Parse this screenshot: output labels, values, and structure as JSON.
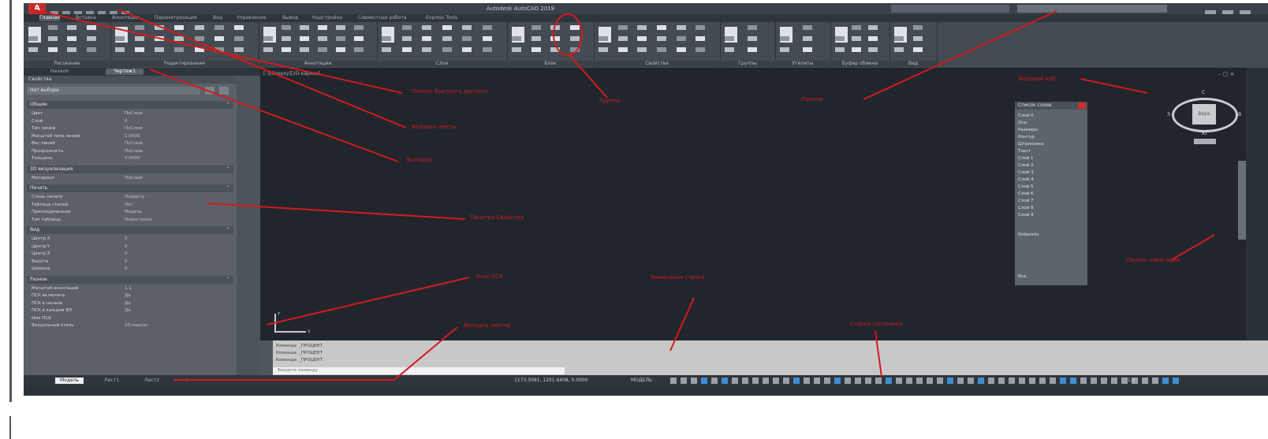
{
  "window": {
    "app_icon": "A",
    "title": "Autodesk AutoCAD 2019"
  },
  "ribbon_tabs": [
    {
      "label": "Главная",
      "active": true
    },
    {
      "label": "Вставка",
      "active": false
    },
    {
      "label": "Аннотации",
      "active": false
    },
    {
      "label": "Параметризация",
      "active": false
    },
    {
      "label": "Вид",
      "active": false
    },
    {
      "label": "Управление",
      "active": false
    },
    {
      "label": "Вывод",
      "active": false
    },
    {
      "label": "Надстройки",
      "active": false
    },
    {
      "label": "Совместная работа",
      "active": false
    },
    {
      "label": "Express Tools",
      "active": false
    }
  ],
  "ribbon_panels": [
    "Рисование",
    "Редактирование",
    "Аннотации",
    "Слои",
    "Блок",
    "Свойства",
    "Группы",
    "Утилиты",
    "Буфер обмена",
    "Вид"
  ],
  "left_tabs": [
    {
      "label": "Начало",
      "active": false
    },
    {
      "label": "Чертеж1",
      "active": true
    }
  ],
  "properties": {
    "header": "Свойства",
    "selection": "Нет выбора",
    "sections": [
      {
        "title": "Общие",
        "rows": [
          {
            "label": "Цвет",
            "value": "ПоСлою"
          },
          {
            "label": "Слой",
            "value": "0"
          },
          {
            "label": "Тип линий",
            "value": "ПоСлою"
          },
          {
            "label": "Масштаб типа линий",
            "value": "1.0000"
          },
          {
            "label": "Вес линий",
            "value": "ПоСлою"
          },
          {
            "label": "Прозрачность",
            "value": "ПоСлою"
          },
          {
            "label": "Толщина",
            "value": "0.0000"
          }
        ]
      },
      {
        "title": "3D визуализация",
        "rows": [
          {
            "label": "Материал",
            "value": "ПоСлою"
          }
        ]
      },
      {
        "title": "Печать",
        "rows": [
          {
            "label": "Стиль печати",
            "value": "ПоЦвету"
          },
          {
            "label": "Таблица стилей",
            "value": "Нет"
          },
          {
            "label": "Присоединенная",
            "value": "Модель"
          },
          {
            "label": "Тип таблицы",
            "value": "Недоступно"
          }
        ]
      },
      {
        "title": "Вид",
        "rows": [
          {
            "label": "Центр X",
            "value": "0"
          },
          {
            "label": "Центр Y",
            "value": "0"
          },
          {
            "label": "Центр Z",
            "value": "0"
          },
          {
            "label": "Высота",
            "value": "0"
          },
          {
            "label": "Ширина",
            "value": "0"
          }
        ]
      },
      {
        "title": "Разное",
        "rows": [
          {
            "label": "Масштаб аннотаций",
            "value": "1:1"
          },
          {
            "label": "ПСК включена",
            "value": "Да"
          },
          {
            "label": "ПСК в начале",
            "value": "Да"
          },
          {
            "label": "ПСК в каждом ВЭ",
            "value": "Да"
          },
          {
            "label": "Имя ПСК",
            "value": ""
          },
          {
            "label": "Визуальный стиль",
            "value": "2D-каркас"
          }
        ]
      }
    ]
  },
  "viewport": {
    "label": "[–][Сверху][2D-каркас]",
    "controls": "– ▢ ×"
  },
  "viewcube": {
    "face": "Верх",
    "north": "С",
    "south": "Ю",
    "west": "З",
    "east": "В"
  },
  "layer_palette": {
    "title": "Список слоев",
    "items": [
      "Слой 0",
      "Оси",
      "Размеры",
      "Контур",
      "Штриховка",
      "Текст",
      "Слой 1",
      "Слой 2",
      "Слой 3",
      "Слой 4",
      "Слой 5",
      "Слой 6",
      "Слой 7",
      "Слой 8",
      "Слой 9"
    ],
    "footer_items": [
      "Defpoints",
      "Все"
    ]
  },
  "ucs": {
    "x": "X",
    "y": "Y"
  },
  "command": {
    "history": [
      "Команда: _ПРОЦЕНТ",
      "Команда: _ПРОЦЕНТ",
      "Команда: _ПРОЦЕНТ"
    ],
    "placeholder": "Введите команду"
  },
  "status_tabs": [
    {
      "label": "Модель",
      "active": true
    },
    {
      "label": "Лист1",
      "active": false
    },
    {
      "label": "Лист2",
      "active": false
    },
    {
      "label": "+",
      "active": false
    }
  ],
  "status": {
    "coordinates": "1173.3091, 1201.6408, 0.0000",
    "model_label": "МОДЕЛЬ",
    "scale": "1:1"
  },
  "annotations": {
    "quick_access": "Панель быстрого доступа",
    "ribbon_tabs": "Вкладки ленты",
    "tabs": "Вкладки",
    "properties": "Палитра Свойства",
    "ucs": "Знак ПСК",
    "command_line": "Командная строка",
    "model_tabs": "Вкладки листов",
    "status_bar": "Строка состояния",
    "viewcube": "Видовой куб",
    "navbar": "Панель навигации",
    "panels": "Панели",
    "group": "Группа"
  },
  "colors": {
    "annotation": "#d21b1b",
    "canvas": "#21262d",
    "ribbon": "#454b53"
  }
}
